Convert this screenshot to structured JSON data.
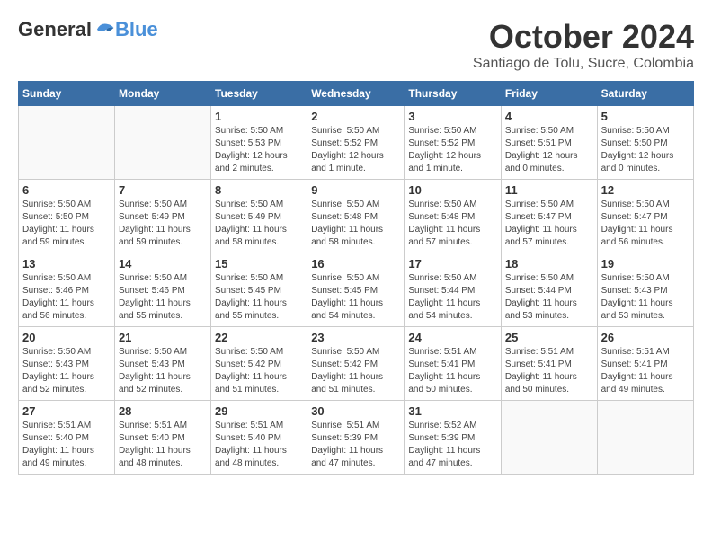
{
  "logo": {
    "general": "General",
    "blue": "Blue"
  },
  "title": "October 2024",
  "location": "Santiago de Tolu, Sucre, Colombia",
  "days_header": [
    "Sunday",
    "Monday",
    "Tuesday",
    "Wednesday",
    "Thursday",
    "Friday",
    "Saturday"
  ],
  "weeks": [
    [
      {
        "day": "",
        "info": ""
      },
      {
        "day": "",
        "info": ""
      },
      {
        "day": "1",
        "info": "Sunrise: 5:50 AM\nSunset: 5:53 PM\nDaylight: 12 hours\nand 2 minutes."
      },
      {
        "day": "2",
        "info": "Sunrise: 5:50 AM\nSunset: 5:52 PM\nDaylight: 12 hours\nand 1 minute."
      },
      {
        "day": "3",
        "info": "Sunrise: 5:50 AM\nSunset: 5:52 PM\nDaylight: 12 hours\nand 1 minute."
      },
      {
        "day": "4",
        "info": "Sunrise: 5:50 AM\nSunset: 5:51 PM\nDaylight: 12 hours\nand 0 minutes."
      },
      {
        "day": "5",
        "info": "Sunrise: 5:50 AM\nSunset: 5:50 PM\nDaylight: 12 hours\nand 0 minutes."
      }
    ],
    [
      {
        "day": "6",
        "info": "Sunrise: 5:50 AM\nSunset: 5:50 PM\nDaylight: 11 hours\nand 59 minutes."
      },
      {
        "day": "7",
        "info": "Sunrise: 5:50 AM\nSunset: 5:49 PM\nDaylight: 11 hours\nand 59 minutes."
      },
      {
        "day": "8",
        "info": "Sunrise: 5:50 AM\nSunset: 5:49 PM\nDaylight: 11 hours\nand 58 minutes."
      },
      {
        "day": "9",
        "info": "Sunrise: 5:50 AM\nSunset: 5:48 PM\nDaylight: 11 hours\nand 58 minutes."
      },
      {
        "day": "10",
        "info": "Sunrise: 5:50 AM\nSunset: 5:48 PM\nDaylight: 11 hours\nand 57 minutes."
      },
      {
        "day": "11",
        "info": "Sunrise: 5:50 AM\nSunset: 5:47 PM\nDaylight: 11 hours\nand 57 minutes."
      },
      {
        "day": "12",
        "info": "Sunrise: 5:50 AM\nSunset: 5:47 PM\nDaylight: 11 hours\nand 56 minutes."
      }
    ],
    [
      {
        "day": "13",
        "info": "Sunrise: 5:50 AM\nSunset: 5:46 PM\nDaylight: 11 hours\nand 56 minutes."
      },
      {
        "day": "14",
        "info": "Sunrise: 5:50 AM\nSunset: 5:46 PM\nDaylight: 11 hours\nand 55 minutes."
      },
      {
        "day": "15",
        "info": "Sunrise: 5:50 AM\nSunset: 5:45 PM\nDaylight: 11 hours\nand 55 minutes."
      },
      {
        "day": "16",
        "info": "Sunrise: 5:50 AM\nSunset: 5:45 PM\nDaylight: 11 hours\nand 54 minutes."
      },
      {
        "day": "17",
        "info": "Sunrise: 5:50 AM\nSunset: 5:44 PM\nDaylight: 11 hours\nand 54 minutes."
      },
      {
        "day": "18",
        "info": "Sunrise: 5:50 AM\nSunset: 5:44 PM\nDaylight: 11 hours\nand 53 minutes."
      },
      {
        "day": "19",
        "info": "Sunrise: 5:50 AM\nSunset: 5:43 PM\nDaylight: 11 hours\nand 53 minutes."
      }
    ],
    [
      {
        "day": "20",
        "info": "Sunrise: 5:50 AM\nSunset: 5:43 PM\nDaylight: 11 hours\nand 52 minutes."
      },
      {
        "day": "21",
        "info": "Sunrise: 5:50 AM\nSunset: 5:43 PM\nDaylight: 11 hours\nand 52 minutes."
      },
      {
        "day": "22",
        "info": "Sunrise: 5:50 AM\nSunset: 5:42 PM\nDaylight: 11 hours\nand 51 minutes."
      },
      {
        "day": "23",
        "info": "Sunrise: 5:50 AM\nSunset: 5:42 PM\nDaylight: 11 hours\nand 51 minutes."
      },
      {
        "day": "24",
        "info": "Sunrise: 5:51 AM\nSunset: 5:41 PM\nDaylight: 11 hours\nand 50 minutes."
      },
      {
        "day": "25",
        "info": "Sunrise: 5:51 AM\nSunset: 5:41 PM\nDaylight: 11 hours\nand 50 minutes."
      },
      {
        "day": "26",
        "info": "Sunrise: 5:51 AM\nSunset: 5:41 PM\nDaylight: 11 hours\nand 49 minutes."
      }
    ],
    [
      {
        "day": "27",
        "info": "Sunrise: 5:51 AM\nSunset: 5:40 PM\nDaylight: 11 hours\nand 49 minutes."
      },
      {
        "day": "28",
        "info": "Sunrise: 5:51 AM\nSunset: 5:40 PM\nDaylight: 11 hours\nand 48 minutes."
      },
      {
        "day": "29",
        "info": "Sunrise: 5:51 AM\nSunset: 5:40 PM\nDaylight: 11 hours\nand 48 minutes."
      },
      {
        "day": "30",
        "info": "Sunrise: 5:51 AM\nSunset: 5:39 PM\nDaylight: 11 hours\nand 47 minutes."
      },
      {
        "day": "31",
        "info": "Sunrise: 5:52 AM\nSunset: 5:39 PM\nDaylight: 11 hours\nand 47 minutes."
      },
      {
        "day": "",
        "info": ""
      },
      {
        "day": "",
        "info": ""
      }
    ]
  ]
}
